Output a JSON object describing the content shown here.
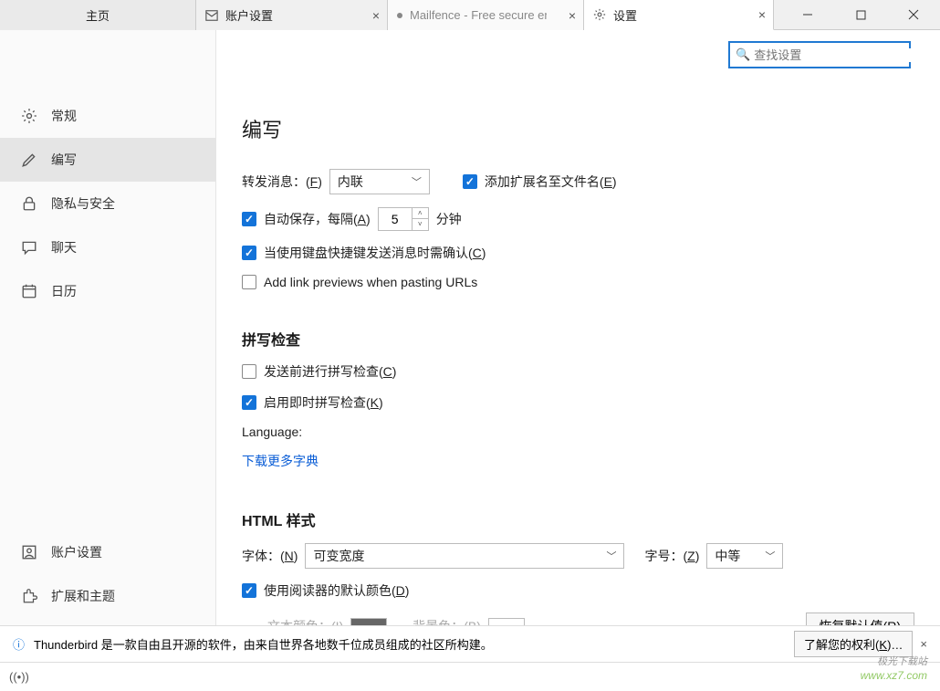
{
  "tabs": {
    "home": "主页",
    "account": "账户设置",
    "mailfence": "Mailfence - Free secure em",
    "settings": "设置"
  },
  "search": {
    "placeholder": "查找设置"
  },
  "sidebar": {
    "general": "常规",
    "compose": "编写",
    "privacy": "隐私与安全",
    "chat": "聊天",
    "calendar": "日历",
    "account_settings": "账户设置",
    "extensions": "扩展和主题"
  },
  "content": {
    "title": "编写",
    "forward_label_pre": "转发消息：(",
    "forward_label_post": ")",
    "forward_key": "F",
    "forward_select": "内联",
    "addext_pre": "添加扩展名至文件名(",
    "addext_key": "E",
    "addext_post": ")",
    "autosave_pre": "自动保存，每隔(",
    "autosave_key": "A",
    "autosave_post": ")",
    "autosave_value": "5",
    "autosave_unit": "分钟",
    "confirm_pre": "当使用键盘快捷键发送消息时需确认(",
    "confirm_key": "C",
    "confirm_post": ")",
    "linkpreview": "Add link previews when pasting URLs",
    "spell_title": "拼写检查",
    "spell_before_pre": "发送前进行拼写检查(",
    "spell_before_key": "C",
    "spell_before_post": ")",
    "spell_inline_pre": "启用即时拼写检查(",
    "spell_inline_key": "K",
    "spell_inline_post": ")",
    "language_label": "Language:",
    "download_dict": "下载更多字典",
    "html_title": "HTML 样式",
    "font_label_pre": "字体：(",
    "font_key": "N",
    "font_label_post": ")",
    "font_select": "可变宽度",
    "size_label_pre": "字号：(",
    "size_key": "Z",
    "size_label_post": ")",
    "size_select": "中等",
    "reader_color_pre": "使用阅读器的默认颜色(",
    "reader_color_key": "D",
    "reader_color_post": ")",
    "text_color_pre": "文本颜色：(",
    "text_color_key": "I",
    "text_color_post": ")",
    "bg_color_pre": "背景色：(",
    "bg_color_key": "B",
    "bg_color_post": ")",
    "restore_pre": "恢复默认值(",
    "restore_key": "R",
    "restore_post": ")"
  },
  "footer": {
    "message": "Thunderbird 是一款自由且开源的软件，由来自世界各地数千位成员组成的社区所构建。",
    "rights_pre": "了解您的权利(",
    "rights_key": "K",
    "rights_post": ")…"
  },
  "watermark": {
    "cn": "极光下载站",
    "url": "www.xz7.com"
  }
}
